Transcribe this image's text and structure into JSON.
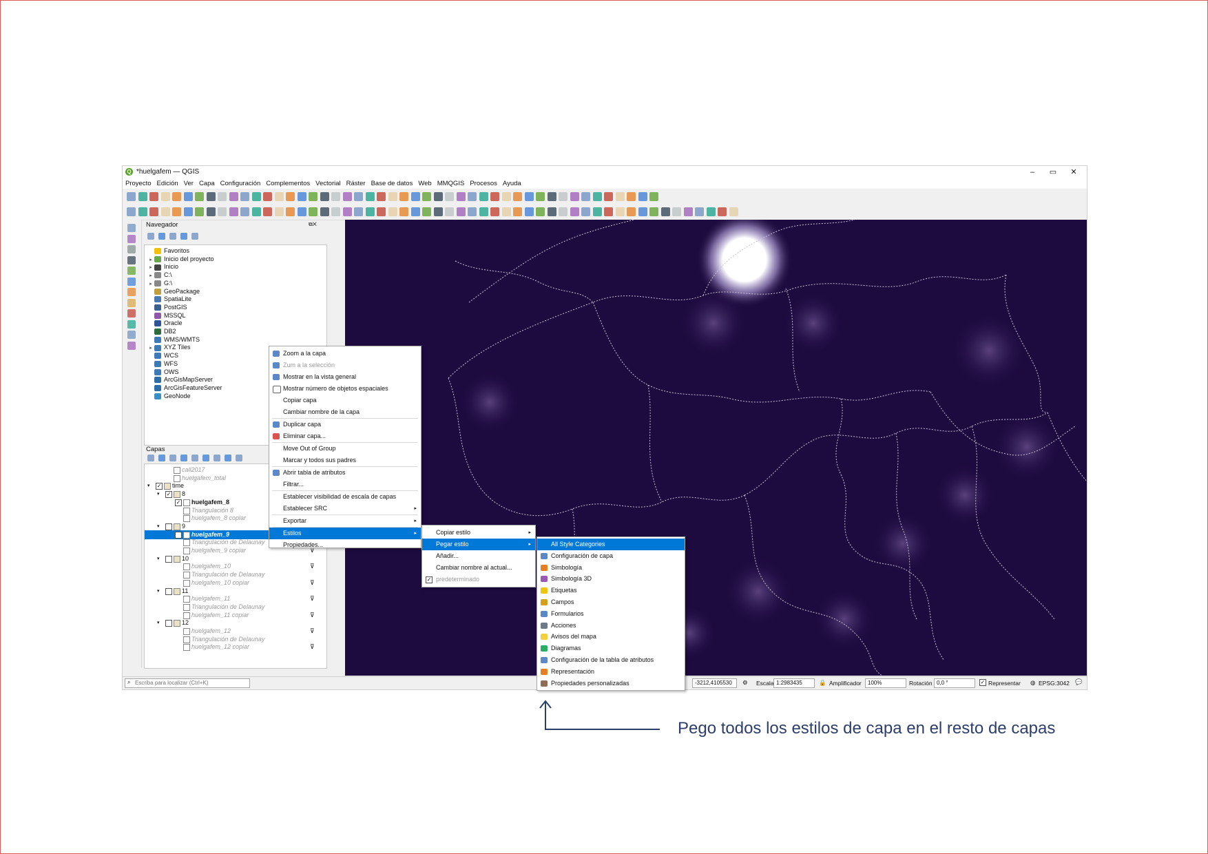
{
  "window": {
    "title": "*huelgafem — QGIS",
    "controls": [
      "–",
      "▭",
      "✕"
    ]
  },
  "menubar": [
    "Proyecto",
    "Edición",
    "Ver",
    "Capa",
    "Configuración",
    "Complementos",
    "Vectorial",
    "Ráster",
    "Base de datos",
    "Web",
    "MMQGIS",
    "Procesos",
    "Ayuda"
  ],
  "navigator": {
    "title": "Navegador",
    "items": [
      {
        "label": "Favoritos",
        "icon": "star-icon",
        "expand": false
      },
      {
        "label": "Inicio del proyecto",
        "icon": "project-home-icon",
        "expand": true
      },
      {
        "label": "Inicio",
        "icon": "home-icon",
        "expand": true
      },
      {
        "label": "C:\\",
        "icon": "drive-icon",
        "expand": true
      },
      {
        "label": "G:\\",
        "icon": "drive-icon",
        "expand": true
      },
      {
        "label": "GeoPackage",
        "icon": "geopackage-icon",
        "expand": false
      },
      {
        "label": "SpatiaLite",
        "icon": "spatialite-icon",
        "expand": false
      },
      {
        "label": "PostGIS",
        "icon": "postgis-icon",
        "expand": false
      },
      {
        "label": "MSSQL",
        "icon": "mssql-icon",
        "expand": false
      },
      {
        "label": "Oracle",
        "icon": "oracle-icon",
        "expand": false
      },
      {
        "label": "DB2",
        "icon": "db2-icon",
        "expand": false
      },
      {
        "label": "WMS/WMTS",
        "icon": "wms-icon",
        "expand": false
      },
      {
        "label": "XYZ Tiles",
        "icon": "xyz-icon",
        "expand": true
      },
      {
        "label": "WCS",
        "icon": "wcs-icon",
        "expand": false
      },
      {
        "label": "WFS",
        "icon": "wfs-icon",
        "expand": false
      },
      {
        "label": "OWS",
        "icon": "ows-icon",
        "expand": false
      },
      {
        "label": "ArcGisMapServer",
        "icon": "arcgis-icon",
        "expand": false
      },
      {
        "label": "ArcGisFeatureServer",
        "icon": "arcgis-icon",
        "expand": false
      },
      {
        "label": "GeoNode",
        "icon": "geonode-icon",
        "expand": false
      }
    ]
  },
  "layers": {
    "title": "Capas",
    "items": [
      {
        "label": "call2017",
        "indent": 1,
        "style": "grey",
        "check": "none",
        "expand": "",
        "filter": false
      },
      {
        "label": "huelgafem_total",
        "indent": 1,
        "style": "grey",
        "check": "none",
        "expand": "",
        "filter": false
      },
      {
        "label": "time",
        "indent": 0,
        "style": "normal",
        "check": "checked",
        "expand": "▾",
        "filter": false
      },
      {
        "label": "8",
        "indent": 1,
        "style": "normal",
        "check": "checked",
        "expand": "▾",
        "filter": false
      },
      {
        "label": "huelgafem_8",
        "indent": 2,
        "style": "bold",
        "check": "checked",
        "expand": "",
        "filter": false
      },
      {
        "label": "Triangulación 8",
        "indent": 2,
        "style": "grey",
        "check": "none",
        "expand": "",
        "filter": false
      },
      {
        "label": "huelgafem_8 copiar",
        "indent": 2,
        "style": "grey",
        "check": "none",
        "expand": "",
        "filter": false
      },
      {
        "label": "9",
        "indent": 1,
        "style": "normal",
        "check": "unchecked",
        "expand": "▾",
        "filter": false
      },
      {
        "label": "huelgafem_9",
        "indent": 2,
        "style": "selected",
        "check": "unchecked",
        "expand": "",
        "filter": false
      },
      {
        "label": "Triangulación de Delaunay",
        "indent": 2,
        "style": "grey",
        "check": "none",
        "expand": "",
        "filter": false
      },
      {
        "label": "huelgafem_9 copiar",
        "indent": 2,
        "style": "grey",
        "check": "none",
        "expand": "",
        "filter": true
      },
      {
        "label": "10",
        "indent": 1,
        "style": "normal",
        "check": "unchecked",
        "expand": "▾",
        "filter": false
      },
      {
        "label": "huelgafem_10",
        "indent": 2,
        "style": "grey",
        "check": "none",
        "expand": "",
        "filter": true
      },
      {
        "label": "Triangulación de Delaunay",
        "indent": 2,
        "style": "grey",
        "check": "none",
        "expand": "",
        "filter": false
      },
      {
        "label": "huelgafem_10 copiar",
        "indent": 2,
        "style": "grey",
        "check": "none",
        "expand": "",
        "filter": true
      },
      {
        "label": "11",
        "indent": 1,
        "style": "normal",
        "check": "unchecked",
        "expand": "▾",
        "filter": false
      },
      {
        "label": "huelgafem_11",
        "indent": 2,
        "style": "grey",
        "check": "none",
        "expand": "",
        "filter": true
      },
      {
        "label": "Triangulación de Delaunay",
        "indent": 2,
        "style": "grey",
        "check": "none",
        "expand": "",
        "filter": false
      },
      {
        "label": "huelgafem_11 copiar",
        "indent": 2,
        "style": "grey",
        "check": "none",
        "expand": "",
        "filter": true
      },
      {
        "label": "12",
        "indent": 1,
        "style": "normal",
        "check": "unchecked",
        "expand": "▾",
        "filter": false
      },
      {
        "label": "huelgafem_12",
        "indent": 2,
        "style": "grey",
        "check": "none",
        "expand": "",
        "filter": true
      },
      {
        "label": "Triangulación de Delaunay",
        "indent": 2,
        "style": "grey",
        "check": "none",
        "expand": "",
        "filter": false
      },
      {
        "label": "huelgafem_12 copiar",
        "indent": 2,
        "style": "grey",
        "check": "none",
        "expand": "",
        "filter": true
      }
    ]
  },
  "context_menu": {
    "items": [
      {
        "label": "Zoom a la capa",
        "icon": "zoom-layer-icon",
        "disabled": false
      },
      {
        "label": "Zum a la selección",
        "icon": "zoom-selection-icon",
        "disabled": true
      },
      {
        "label": "Mostrar en la vista general",
        "icon": "overview-icon",
        "disabled": false
      },
      {
        "label": "Mostrar número de objetos espaciales",
        "icon": "checkbox-icon",
        "disabled": false
      },
      {
        "label": "Copiar capa",
        "icon": "",
        "disabled": false
      },
      {
        "label": "Cambiar nombre de la capa",
        "icon": "",
        "disabled": false,
        "sep_after": true
      },
      {
        "label": "Duplicar capa",
        "icon": "duplicate-icon",
        "disabled": false
      },
      {
        "label": "Eliminar capa...",
        "icon": "remove-layer-icon",
        "disabled": false,
        "sep_after": true
      },
      {
        "label": "Move Out of Group",
        "icon": "",
        "disabled": false
      },
      {
        "label": "Marcar y todos sus padres",
        "icon": "",
        "disabled": false,
        "sep_after": true
      },
      {
        "label": "Abrir tabla de atributos",
        "icon": "table-icon",
        "disabled": false
      },
      {
        "label": "Filtrar...",
        "icon": "",
        "disabled": false,
        "sep_after": true
      },
      {
        "label": "Establecer visibilidad de escala de capas",
        "icon": "",
        "disabled": false
      },
      {
        "label": "Establecer SRC",
        "icon": "",
        "disabled": false,
        "submenu": true,
        "sep_after": true
      },
      {
        "label": "Exportar",
        "icon": "",
        "disabled": false,
        "submenu": true,
        "sep_after": true
      },
      {
        "label": "Estilos",
        "icon": "",
        "disabled": false,
        "submenu": true,
        "highlight": true
      },
      {
        "label": "Propiedades...",
        "icon": "",
        "disabled": false
      }
    ]
  },
  "styles_menu": {
    "items": [
      {
        "label": "Copiar estilo",
        "submenu": true
      },
      {
        "label": "Pegar estilo",
        "submenu": true,
        "highlight": true
      },
      {
        "label": "Añadir...",
        "submenu": false
      },
      {
        "label": "Cambiar nombre al actual...",
        "submenu": false
      },
      {
        "label": "predeterminado",
        "submenu": false,
        "checked": true
      }
    ]
  },
  "paste_menu": {
    "items": [
      {
        "label": "All Style Categories",
        "icon": "",
        "highlight": true
      },
      {
        "label": "Configuración de capa",
        "icon": "layer-config-icon"
      },
      {
        "label": "Simbología",
        "icon": "symbology-icon"
      },
      {
        "label": "Simbología 3D",
        "icon": "symbology-3d-icon"
      },
      {
        "label": "Etiquetas",
        "icon": "labels-icon"
      },
      {
        "label": "Campos",
        "icon": "fields-icon"
      },
      {
        "label": "Formularios",
        "icon": "forms-icon"
      },
      {
        "label": "Acciones",
        "icon": "actions-icon"
      },
      {
        "label": "Avisos del mapa",
        "icon": "map-tips-icon"
      },
      {
        "label": "Diagramas",
        "icon": "diagrams-icon"
      },
      {
        "label": "Configuración de la tabla de atributos",
        "icon": "attribute-table-config-icon"
      },
      {
        "label": "Representación",
        "icon": "rendering-icon"
      },
      {
        "label": "Propiedades personalizadas",
        "icon": "custom-properties-icon"
      }
    ]
  },
  "statusbar": {
    "search_placeholder": "Escriba para localizar (Ctrl+K)",
    "coordinate_value": "-3212,4105530",
    "scale_label": "Escala",
    "scale_value": "1:2983435",
    "magnifier_label": "Amplificador",
    "magnifier_value": "100%",
    "rotation_label": "Rotación",
    "rotation_value": "0,0 °",
    "render_label": "Representar",
    "crs_label": "EPSG:3042"
  },
  "annotation": {
    "text": "Pego todos los estilos de capa en el resto de capas"
  },
  "colors": {
    "map_bg": "#1d0a3f",
    "highlight": "#0078d7",
    "annotation": "#2c3e6b",
    "frame_border": "#e05a5a"
  }
}
